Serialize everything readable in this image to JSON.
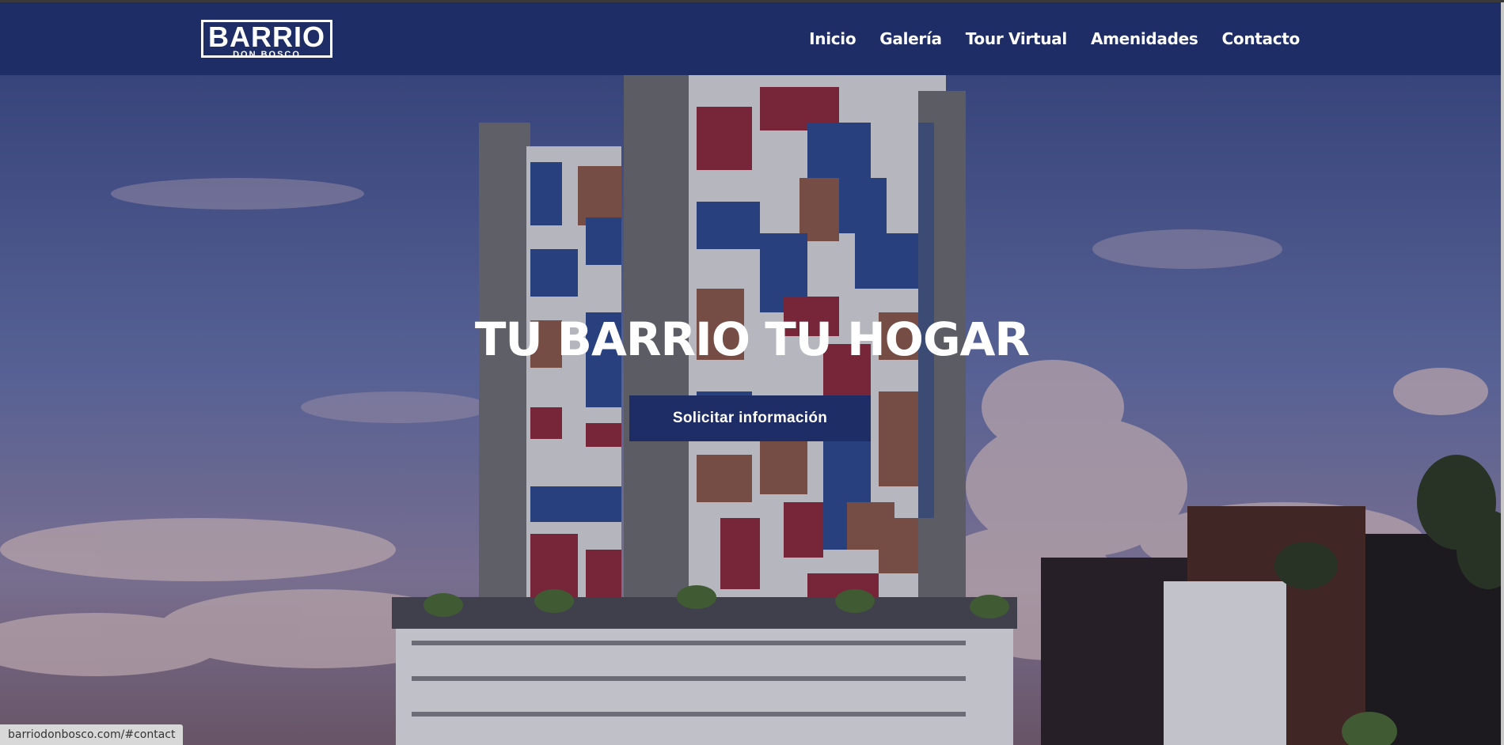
{
  "brand": {
    "name": "BARRIO",
    "subname": "DON BOSCO"
  },
  "nav": {
    "items": [
      "Inicio",
      "Galería",
      "Tour Virtual",
      "Amenidades",
      "Contacto"
    ]
  },
  "hero": {
    "title": "TU BARRIO TU HOGAR",
    "cta_label": "Solicitar información"
  },
  "status_bar": {
    "url": "barriodonbosco.com/#contact"
  },
  "colors": {
    "navy": "#1f2d66",
    "red": "#8b2a3a",
    "blue": "#2c4a8e",
    "brown": "#8a5a48"
  }
}
